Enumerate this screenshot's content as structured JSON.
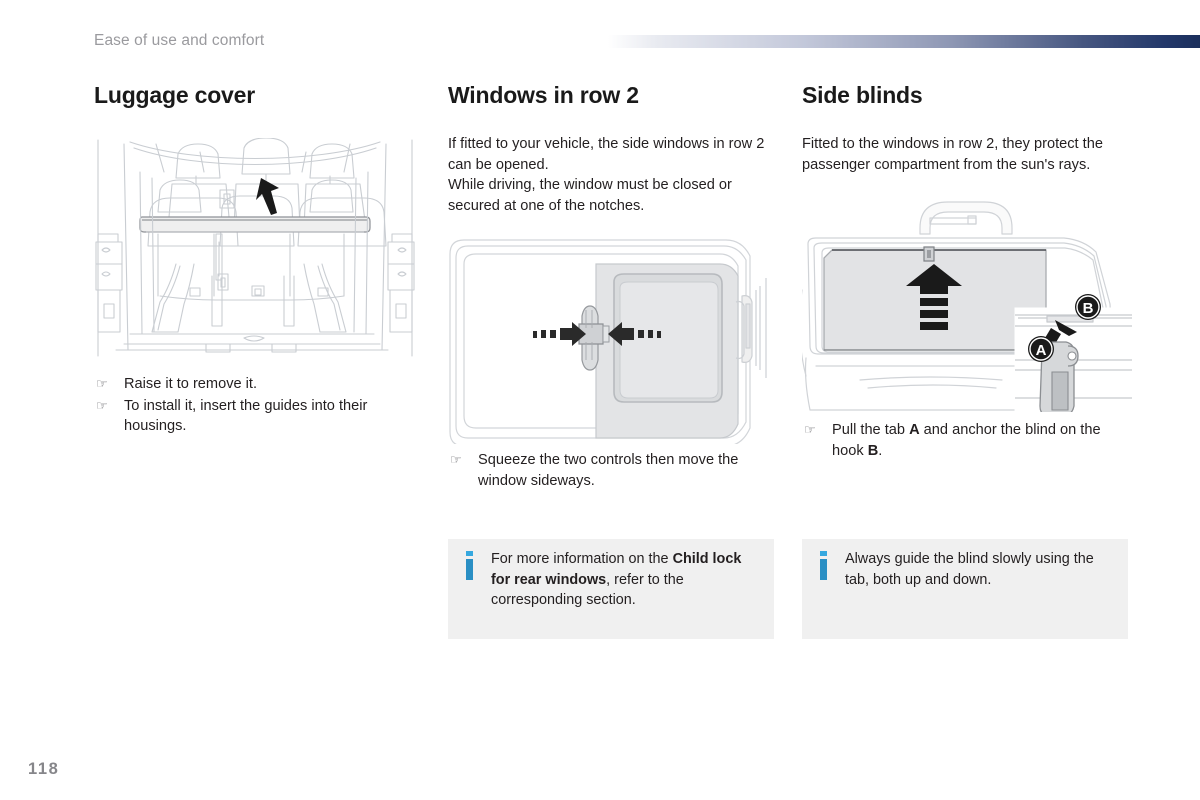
{
  "header": {
    "chapter": "Ease of use and comfort",
    "rule_gradient_from": "#ffffff",
    "rule_gradient_to": "#1b2f5c"
  },
  "page_number": "118",
  "bullet_glyph": "☞",
  "info_icon_color": "#2a8fc4",
  "info_box_bg": "#f0f0f0",
  "columns": {
    "luggage": {
      "title": "Luggage cover",
      "figure_name": "luggage-cover-illustration",
      "bullets": [
        "Raise it to remove it.",
        "To install it, insert the guides into their housings."
      ]
    },
    "windows": {
      "title": "Windows in row 2",
      "intro_line1": "If fitted to your vehicle, the side windows in row 2 can be opened.",
      "intro_line2": "While driving, the window must be closed or secured at one of the notches.",
      "figure_name": "row-2-window-illustration",
      "bullets": [
        "Squeeze the two controls then move the window sideways."
      ],
      "info": {
        "text_before": "For more information on the ",
        "text_bold": "Child lock for rear windows",
        "text_after": ", refer to the corresponding section."
      }
    },
    "blinds": {
      "title": "Side blinds",
      "intro": "Fitted to the windows in row 2, they protect the passenger compartment from the sun's rays.",
      "figure_name": "side-blind-illustration",
      "callout_a": "A",
      "callout_b": "B",
      "bullet": {
        "text_before": "Pull the tab ",
        "bold_a": "A",
        "text_middle": " and anchor the blind on the hook ",
        "bold_b": "B",
        "text_after": "."
      },
      "info": {
        "text": "Always guide the blind slowly using the tab, both up and down."
      }
    }
  }
}
